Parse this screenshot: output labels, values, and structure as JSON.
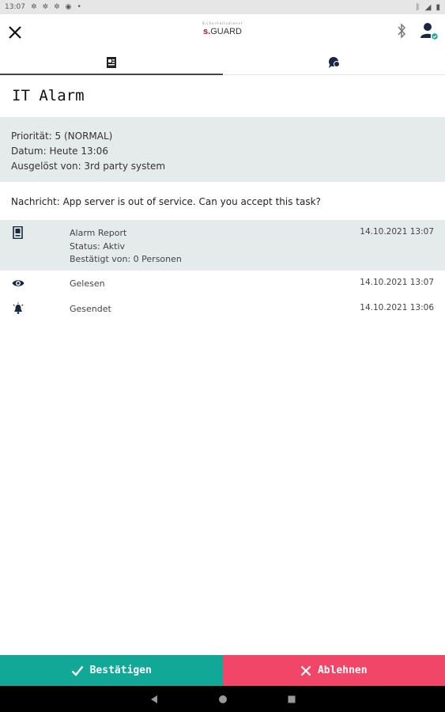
{
  "status_bar": {
    "time": "13:07"
  },
  "header": {
    "logo_small": "Sicherheitsdienst",
    "logo_prefix": "s.",
    "logo_main": "GUARD"
  },
  "tabs": [
    {
      "icon": "document-icon",
      "active": true
    },
    {
      "icon": "chat-icon",
      "active": false
    }
  ],
  "alarm": {
    "title": "IT Alarm",
    "priority": "Priorität: 5 (NORMAL)",
    "date": "Datum: Heute 13:06",
    "triggered_by": "Ausgelöst von: 3rd party system",
    "message": "Nachricht: App server is out of service. Can you accept this task?"
  },
  "history": [
    {
      "icon": "report-icon",
      "title": "Alarm Report",
      "status": "Status: Aktiv",
      "confirmed": "Bestätigt von: 0 Personen",
      "date": "14.10.2021 13:07"
    },
    {
      "icon": "eye-icon",
      "title": "Gelesen",
      "date": "14.10.2021 13:07"
    },
    {
      "icon": "bell-icon",
      "title": "Gesendet",
      "date": "14.10.2021 13:06"
    }
  ],
  "actions": {
    "accept_label": "Bestätigen",
    "reject_label": "Ablehnen"
  },
  "colors": {
    "accept": "#12a898",
    "reject": "#f24668",
    "highlight_bg": "#e5eaeb",
    "logo_red": "#d10a1e"
  }
}
